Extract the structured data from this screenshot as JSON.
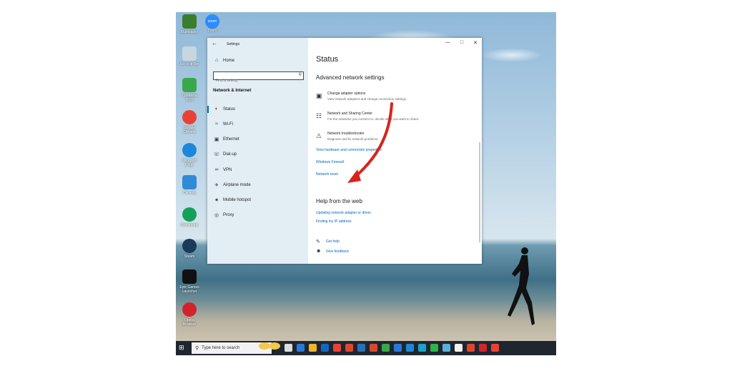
{
  "desktop": {
    "icons": [
      {
        "label": "Bluestacks",
        "color": "#3a7d2c"
      },
      {
        "label": "Recycle Bin",
        "color": "#c8d6e0"
      },
      {
        "label": "Camtasia 2020",
        "color": "#3aa84a"
      },
      {
        "label": "Google Chrome",
        "color": "#e94235"
      },
      {
        "label": "Microsoft Edge",
        "color": "#1e88d8"
      },
      {
        "label": "Cleverfy",
        "color": "#2f8ad8"
      },
      {
        "label": "Grammarly",
        "color": "#15a05a"
      },
      {
        "label": "Steam",
        "color": "#1b3a5a"
      },
      {
        "label": "Epic Games Launcher",
        "color": "#111111"
      },
      {
        "label": "Opera Browser",
        "color": "#d3222a"
      }
    ],
    "zoom_label": "Zoom",
    "zoom_badge": "zoom"
  },
  "settings": {
    "titlebar": "Settings",
    "sidebar": {
      "home": "Home",
      "search_placeholder": "Find a setting",
      "section": "Network & Internet",
      "items": [
        {
          "label": "Status",
          "icon": "status-icon"
        },
        {
          "label": "Wi-Fi",
          "icon": "wifi-icon"
        },
        {
          "label": "Ethernet",
          "icon": "ethernet-icon"
        },
        {
          "label": "Dial-up",
          "icon": "dialup-icon"
        },
        {
          "label": "VPN",
          "icon": "vpn-icon"
        },
        {
          "label": "Airplane mode",
          "icon": "airplane-icon"
        },
        {
          "label": "Mobile hotspot",
          "icon": "hotspot-icon"
        },
        {
          "label": "Proxy",
          "icon": "globe-icon"
        }
      ]
    },
    "main": {
      "title": "Status",
      "advanced_heading": "Advanced network settings",
      "options": [
        {
          "title": "Change adapter options",
          "desc": "View network adapters and change connection settings."
        },
        {
          "title": "Network and Sharing Center",
          "desc": "For the networks you connect to, decide what you want to share."
        },
        {
          "title": "Network troubleshooter",
          "desc": "Diagnose and fix network problems."
        }
      ],
      "links": [
        "View hardware and connection properties",
        "Windows Firewall",
        "Network reset"
      ],
      "help_heading": "Help from the web",
      "help_links": [
        "Updating network adapter or driver",
        "Finding my IP address"
      ],
      "footer": {
        "get_help": "Get help",
        "give_feedback": "Give feedback"
      }
    },
    "annotation_color": "#d8231c"
  },
  "taskbar": {
    "search_placeholder": "Type here to search",
    "app_colors": [
      "#dddddd",
      "#2a79d6",
      "#f0b429",
      "#1565c0",
      "#e94235",
      "#e0452d",
      "#2c6fb8",
      "#d84a2b",
      "#3aa84a",
      "#2a79d6",
      "#1e88d8",
      "#19a3c8",
      "#2cb34a",
      "#5ab0d8",
      "#f2f2f2",
      "#e0452d",
      "#d3222a",
      "#e94235"
    ]
  }
}
